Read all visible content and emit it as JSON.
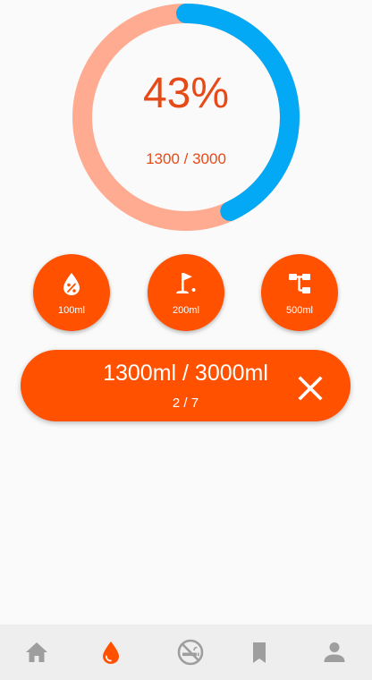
{
  "progress": {
    "percent_label": "43%",
    "amount_label": "1300 / 3000",
    "fraction": 0.43,
    "remaining_color": "#ffab91",
    "progress_color": "#03a9f4",
    "text_color": "#e64a19"
  },
  "quick_add": [
    {
      "label": "100ml",
      "icon": "drop-percent-icon"
    },
    {
      "label": "200ml",
      "icon": "golf-flag-icon"
    },
    {
      "label": "500ml",
      "icon": "hierarchy-icon"
    }
  ],
  "summary": {
    "main_label": "1300ml / 3000ml",
    "sub_label": "2 / 7",
    "close_icon": "close-icon"
  },
  "nav": {
    "items": [
      "home-icon",
      "water-drop-icon",
      "no-smoking-icon",
      "bookmark-icon",
      "person-icon"
    ],
    "active_index": 1,
    "active_color": "#ff5100",
    "inactive_color": "#9e9e9e"
  },
  "colors": {
    "accent": "#ff5100",
    "background": "#fafafa",
    "nav_background": "#eeeeee"
  }
}
